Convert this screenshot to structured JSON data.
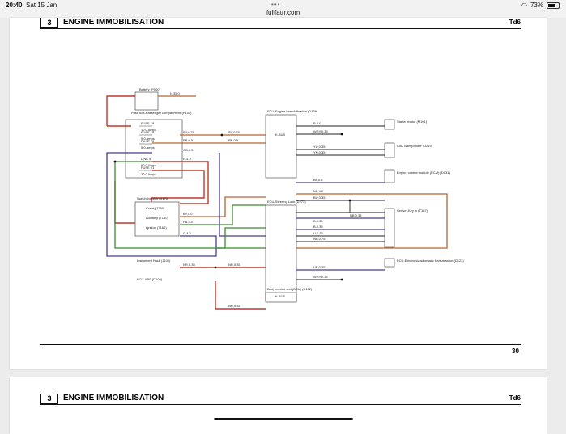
{
  "status": {
    "time": "20:40",
    "date": "Sat 15 Jan",
    "url": "fullfatrr.com",
    "battery": "73%"
  },
  "page": {
    "section": "3",
    "title": "ENGINE IMMOBILISATION",
    "code": "Td6",
    "page_number": "30"
  },
  "page2": {
    "section": "3",
    "title": "ENGINE IMMOBILISATION",
    "code": "Td6"
  },
  "components": {
    "battery": "Battery (P100)",
    "fuse_box": "Fuse box-Passenger compartment (P101)",
    "ecm": "ECU-Engine Immobilisation (D136)",
    "steering_lock": "ECU-Steering Lock (D273)",
    "starter": "Starter motor (M101)",
    "transponder": "Coil-Transponder (D219)",
    "engine_module": "Engine control module (ECM) (D131)",
    "sensor_key": "Sensor-Key in (T157)",
    "switch_ignition": "Switch-Ignition (S176)",
    "instrument_pack": "Instrument Pack (J100)",
    "ecu_abs": "ECU-ABS (D105)",
    "transmission": "ECU-Electronic automatic transmission (D123)",
    "bcu": "Body control unit (BCU) (D162)",
    "kbus": "K-BUS"
  },
  "fuses": [
    "FUSE 18",
    "10.0 Amps",
    "FUSE 19",
    "5.0 Amps",
    "FUSE 20",
    "5.0 Amps",
    "LINK 5",
    "60.0 Amps",
    "FUSE 21",
    "30.0 Amps"
  ],
  "wire_labels": [
    "N,35.0",
    "RY,0.75",
    "PB,0.5",
    "GB,0.5",
    "R,4.0",
    "RY,0.75",
    "PB,0.5",
    "BY,4.0",
    "PB,4.0",
    "G,4.0",
    "NR,0.35",
    "NR,0.35",
    "B,4.0",
    "WRY,0.35",
    "YU,0.35",
    "YN,0.35",
    "BP,0.5",
    "NB,4.0",
    "BU,0.35",
    "NB,0.35",
    "B,0.35",
    "B,0.35",
    "U,0.35",
    "NB,0.75",
    "UB,0.35",
    "WRY,0.35",
    "NR,0.35"
  ],
  "switch_states": [
    "Crank (7160)",
    "Auxiliary (7160)",
    "Ignition (7160)"
  ]
}
